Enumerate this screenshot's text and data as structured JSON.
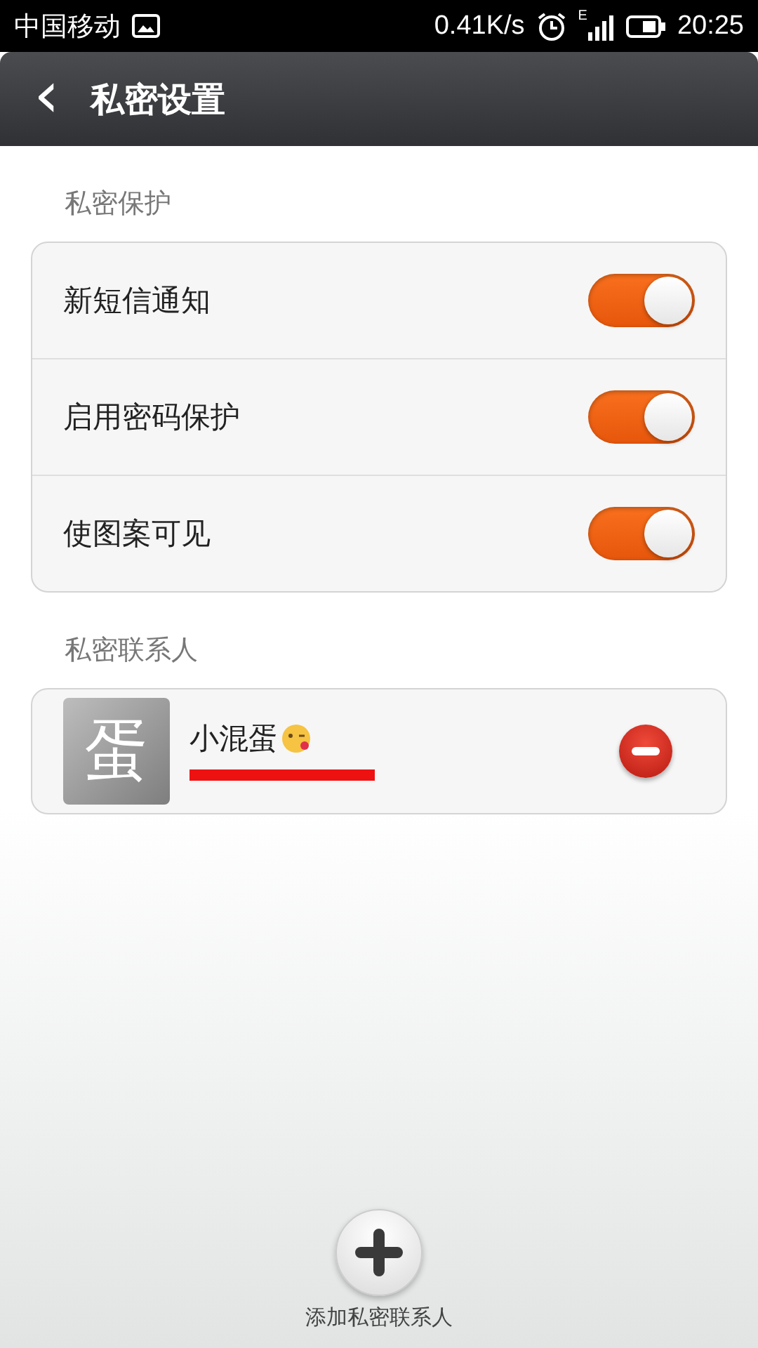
{
  "status_bar": {
    "carrier": "中国移动",
    "speed": "0.41K/s",
    "network": "E",
    "time": "20:25"
  },
  "header": {
    "back": "‹",
    "title": "私密设置"
  },
  "sections": [
    {
      "title": "私密保护",
      "kind": "toggles",
      "items": [
        {
          "label": "新短信通知",
          "on": true
        },
        {
          "label": "启用密码保护",
          "on": true
        },
        {
          "label": "使图案可见",
          "on": true
        }
      ]
    },
    {
      "title": "私密联系人",
      "kind": "contacts",
      "items": [
        {
          "avatar": "蛋",
          "name": "小混蛋",
          "phone_redacted": true
        }
      ]
    }
  ],
  "add_button": {
    "label": "添加私密联系人"
  }
}
